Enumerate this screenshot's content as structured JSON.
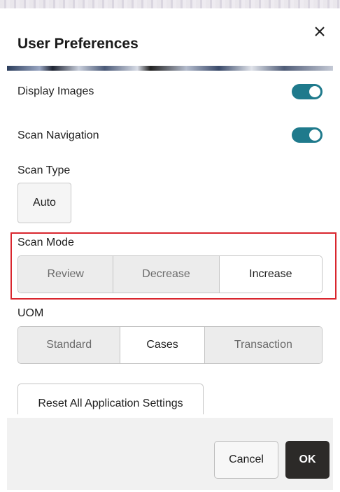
{
  "dialog": {
    "title": "User Preferences",
    "close_icon": "close-icon"
  },
  "settings": {
    "display_images": {
      "label": "Display Images",
      "enabled": true
    },
    "scan_navigation": {
      "label": "Scan Navigation",
      "enabled": true
    },
    "scan_type": {
      "label": "Scan Type",
      "options": [
        "Auto"
      ],
      "selected": "Auto"
    },
    "scan_mode": {
      "label": "Scan Mode",
      "options": [
        "Review",
        "Decrease",
        "Increase"
      ],
      "selected": "Increase"
    },
    "uom": {
      "label": "UOM",
      "options": [
        "Standard",
        "Cases",
        "Transaction"
      ],
      "selected": "Cases"
    }
  },
  "reset_button": "Reset All Application Settings",
  "footer": {
    "cancel": "Cancel",
    "ok": "OK"
  },
  "colors": {
    "toggle_on": "#1f7a8c",
    "highlight": "#d9262e",
    "ok_button": "#2c2a28"
  }
}
